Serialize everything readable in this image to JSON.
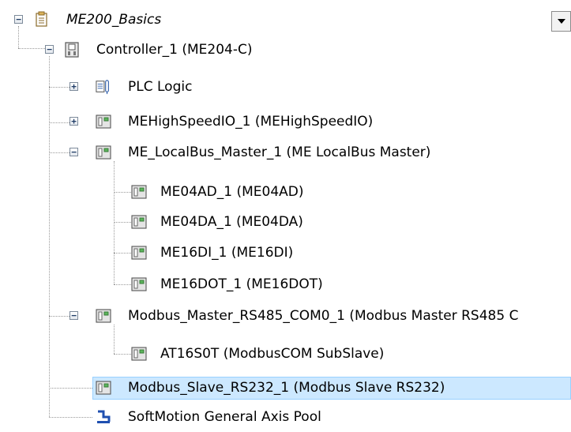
{
  "tree": {
    "root": {
      "label": "ME200_Basics",
      "icon": "project-icon",
      "expanded": true
    },
    "controller": {
      "label": "Controller_1 (ME204-C)",
      "icon": "controller-icon",
      "expanded": true
    },
    "plc_logic": {
      "label": "PLC Logic",
      "icon": "plc-logic-icon",
      "expanded": false
    },
    "highspeed_io": {
      "label": "MEHighSpeedIO_1 (MEHighSpeedIO)",
      "icon": "device-icon",
      "expanded": false
    },
    "localbus": {
      "label": "ME_LocalBus_Master_1 (ME LocalBus Master)",
      "icon": "device-icon",
      "expanded": true
    },
    "me04ad": {
      "label": "ME04AD_1 (ME04AD)",
      "icon": "device-icon"
    },
    "me04da": {
      "label": "ME04DA_1 (ME04DA)",
      "icon": "device-icon"
    },
    "me16di": {
      "label": "ME16DI_1 (ME16DI)",
      "icon": "device-icon"
    },
    "me16dot": {
      "label": "ME16DOT_1 (ME16DOT)",
      "icon": "device-icon"
    },
    "modbus_master": {
      "label": "Modbus_Master_RS485_COM0_1 (Modbus Master RS485 C",
      "icon": "device-icon",
      "expanded": true
    },
    "at16s0t": {
      "label": "AT16S0T (ModbusCOM SubSlave)",
      "icon": "device-icon"
    },
    "modbus_slave": {
      "label": "Modbus_Slave_RS232_1 (Modbus Slave RS232)",
      "icon": "device-icon",
      "selected": true
    },
    "softmotion": {
      "label": "SoftMotion General Axis Pool",
      "icon": "axis-pool-icon"
    }
  },
  "colors": {
    "selection_bg": "#cce8ff",
    "selection_border": "#99d1ff",
    "tree_lines": "#9a9a9a"
  },
  "dropdown": {
    "icon": "chevron-down-icon"
  }
}
